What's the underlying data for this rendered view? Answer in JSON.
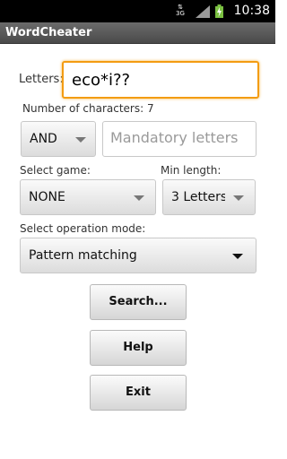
{
  "status_bar": {
    "network_label": "3G",
    "time": "10:38",
    "icons": [
      "3g-icon",
      "signal-icon",
      "battery-charging-icon"
    ]
  },
  "app": {
    "title": "WordCheater"
  },
  "form": {
    "letters_label": "Letters:",
    "letters_value": "eco*i??",
    "num_chars_label": "Number of characters: 7",
    "logic_operator": "AND",
    "mandatory_placeholder": "Mandatory letters",
    "select_game_label": "Select game:",
    "select_game_value": "NONE",
    "min_length_label": "Min length:",
    "min_length_value": "3 Letters",
    "operation_mode_label": "Select operation mode:",
    "operation_mode_value": "Pattern matching"
  },
  "buttons": {
    "search": "Search...",
    "help": "Help",
    "exit": "Exit"
  }
}
